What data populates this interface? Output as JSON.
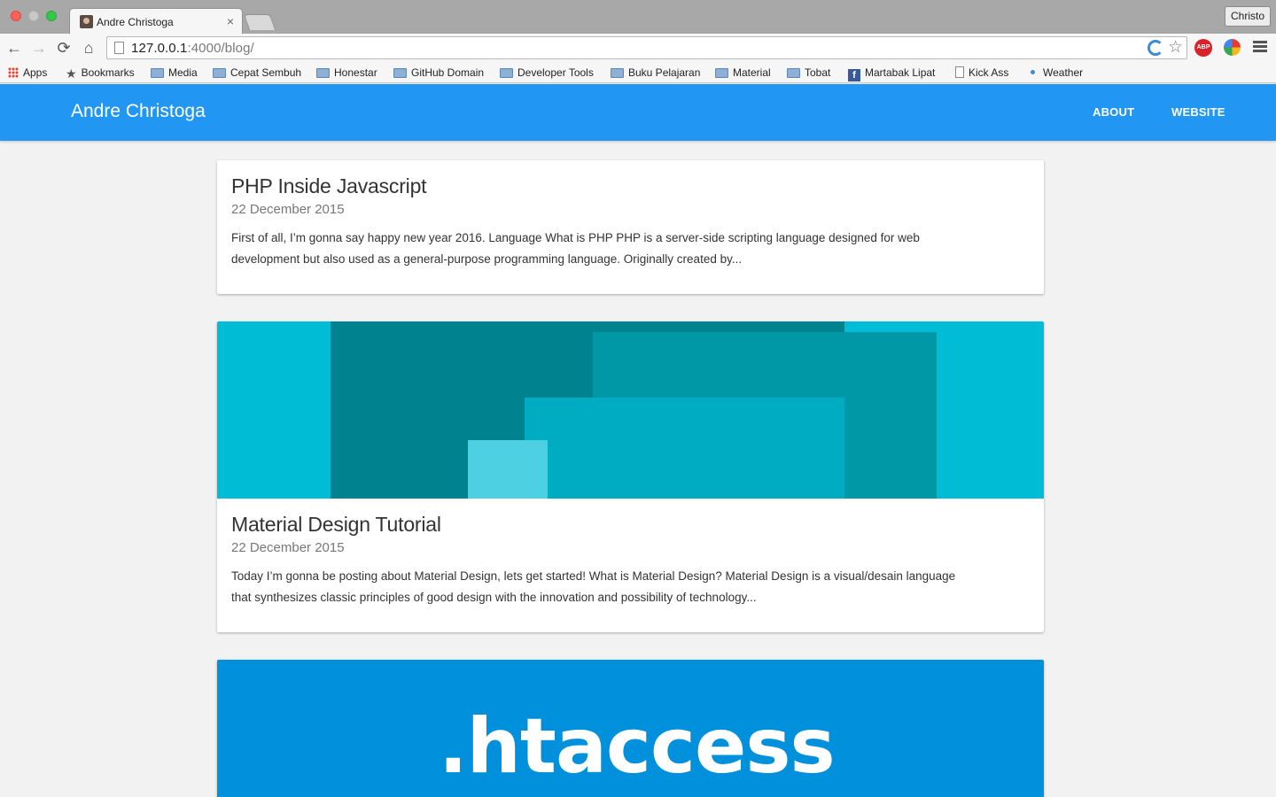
{
  "browser": {
    "tab_title": "Andre Christoga",
    "tab_close": "×",
    "profile_name": "Christo",
    "url_host": "127.0.0.1",
    "url_rest": ":4000/blog/",
    "nav_icons": {
      "back": "←",
      "forward": "→",
      "reload": "⟳",
      "home": "⌂"
    },
    "star": "☆",
    "abp_label": "ABP",
    "bookmarks": [
      {
        "label": "Apps",
        "icon": "apps-grid"
      },
      {
        "label": "Bookmarks",
        "icon": "star"
      },
      {
        "label": "Media",
        "icon": "folder"
      },
      {
        "label": "Cepat Sembuh",
        "icon": "folder"
      },
      {
        "label": "Honestar",
        "icon": "folder"
      },
      {
        "label": "GitHub Domain",
        "icon": "folder"
      },
      {
        "label": "Developer Tools",
        "icon": "folder"
      },
      {
        "label": "Buku Pelajaran",
        "icon": "folder"
      },
      {
        "label": "Material",
        "icon": "folder"
      },
      {
        "label": "Tobat",
        "icon": "folder"
      },
      {
        "label": "Martabak Lipat",
        "icon": "facebook"
      },
      {
        "label": "Kick Ass",
        "icon": "page"
      },
      {
        "label": "Weather",
        "icon": "dot"
      }
    ],
    "fb_glyph": "f",
    "star_glyph": "★"
  },
  "site": {
    "brand": "Andre Christoga",
    "nav": [
      {
        "label": "ABOUT"
      },
      {
        "label": "WEBSITE"
      }
    ]
  },
  "posts": [
    {
      "title": "PHP Inside Javascript",
      "date": "22 December 2015",
      "excerpt": "First of all, I’m gonna say happy new year 2016. Language What is PHP PHP is a server-side scripting language designed for web development but also used as a general-purpose programming language. Originally created by..."
    },
    {
      "title": "Material Design Tutorial",
      "date": "22 December 2015",
      "excerpt": "Today I’m gonna be posting about Material Design, lets get started! What is Material Design? Material Design is a visual/desain language that synthesizes classic principles of good design with the innovation and possibility of technology..."
    },
    {
      "hero_text": ".htaccess"
    }
  ],
  "colors": {
    "header": "#2196f3",
    "md_hero_bg": "#00bcd4",
    "htaccess_hero_bg": "#0090dc"
  }
}
